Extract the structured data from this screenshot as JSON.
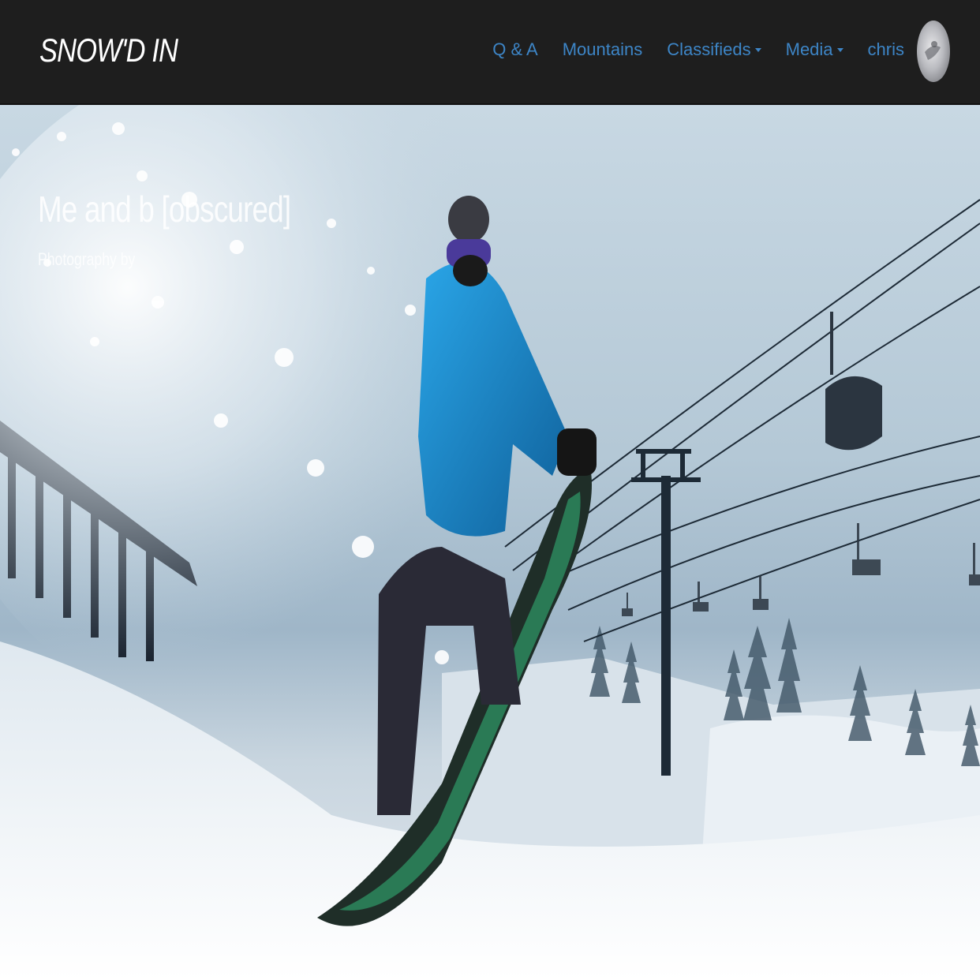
{
  "brand": {
    "name": "SNOW'D IN"
  },
  "nav": {
    "items": [
      {
        "label": "Q & A",
        "dropdown": false
      },
      {
        "label": "Mountains",
        "dropdown": false
      },
      {
        "label": "Classifieds",
        "dropdown": true
      },
      {
        "label": "Media",
        "dropdown": true
      },
      {
        "label": "chris",
        "dropdown": false
      }
    ],
    "link_color": "#3d85c6"
  },
  "hero": {
    "title": "Me and b [obscured]",
    "subtitle": "Photography by",
    "image": "snowboarder-jump-gondola-photo"
  },
  "colors": {
    "navbar_bg": "#1e1e1e",
    "jacket": "#1f8fd0",
    "board": "#2a7a55"
  }
}
